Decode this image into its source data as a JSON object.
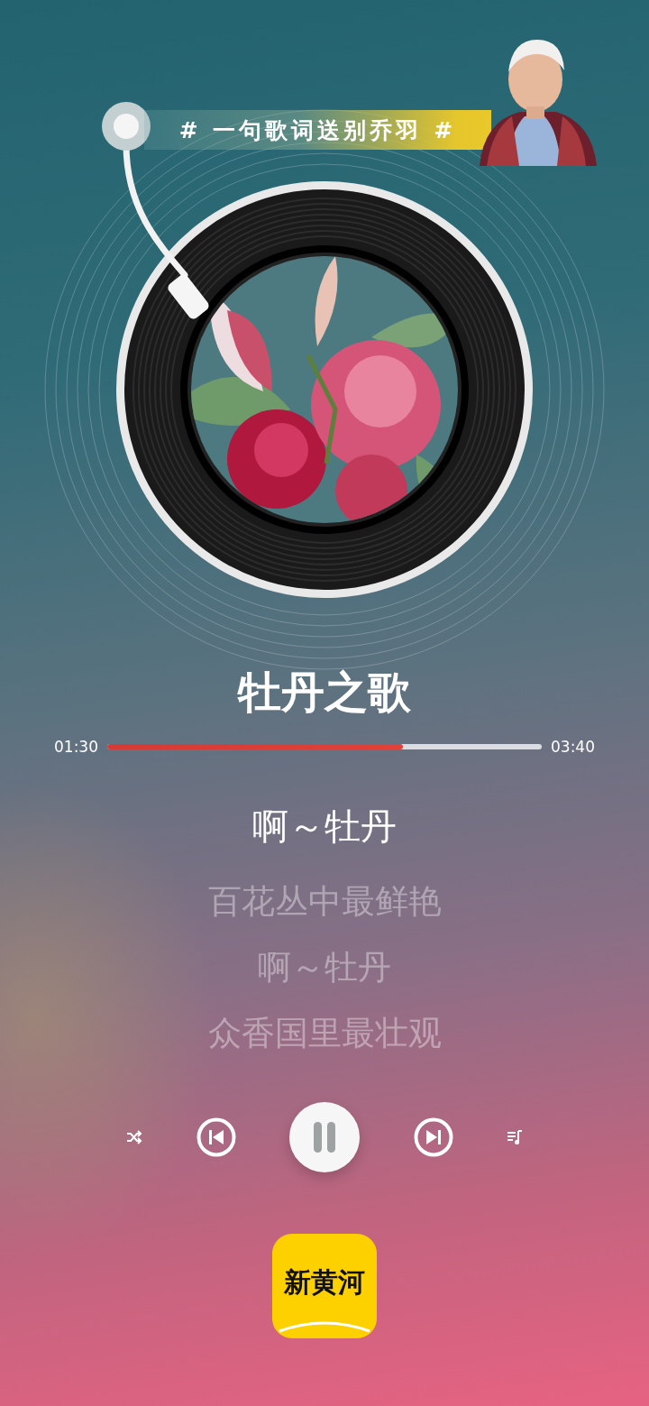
{
  "banner": {
    "text": "# 一句歌词送别乔羽 #"
  },
  "record": {
    "spinning": true
  },
  "song": {
    "title": "牡丹之歌"
  },
  "progress": {
    "elapsed": "01:30",
    "total": "03:40",
    "level": 0.68
  },
  "lyrics": [
    {
      "text": "啊～牡丹",
      "current": true
    },
    {
      "text": "百花丛中最鲜艳",
      "current": false
    },
    {
      "text": "啊～牡丹",
      "current": false
    },
    {
      "text": "众香国里最壮观",
      "current": false
    }
  ],
  "controls": [
    {
      "kind": "shuffle"
    },
    {
      "kind": "previous"
    },
    {
      "kind": "play_pause",
      "playing": true
    },
    {
      "kind": "next"
    },
    {
      "kind": "playlist"
    }
  ],
  "logo": {
    "text": "新黄河"
  }
}
